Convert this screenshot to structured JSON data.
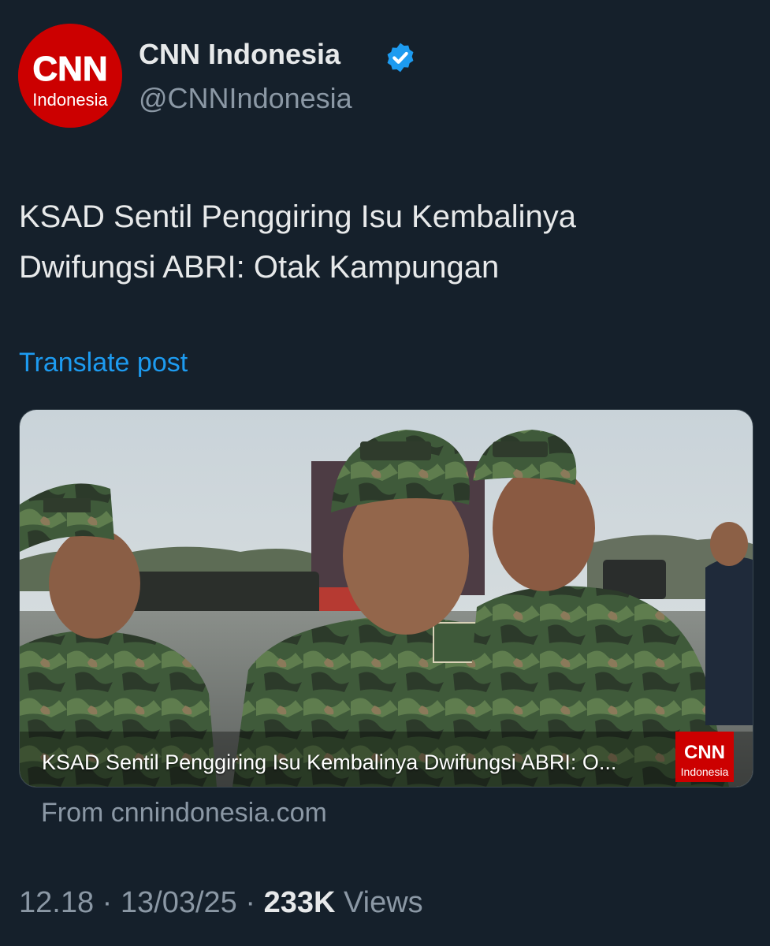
{
  "author": {
    "name": "CNN Indonesia",
    "handle": "@CNNIndonesia",
    "avatar_logo": "CNN",
    "avatar_sub": "Indonesia",
    "verified_icon": "verified-badge-icon"
  },
  "post": {
    "text_lines": [
      "KSAD Sentil Penggiring Isu Kembalinya",
      "Dwifungsi ABRI: Otak Kampungan"
    ],
    "translate_label": "Translate post"
  },
  "link_card": {
    "caption": "KSAD Sentil Penggiring Isu Kembalinya Dwifungsi ABRI: O...",
    "watermark_logo": "CNN",
    "watermark_sub": "Indonesia",
    "source_text": "From cnnindonesia.com",
    "image_subject": "military-officers-photo"
  },
  "meta": {
    "time": "12.18",
    "separator": "·",
    "date": "13/03/25",
    "views_count": "233K",
    "views_label": "Views"
  },
  "colors": {
    "background": "#15202b",
    "link_blue": "#1d9bf0",
    "muted": "#8b98a5",
    "cnn_red": "#cc0000"
  }
}
